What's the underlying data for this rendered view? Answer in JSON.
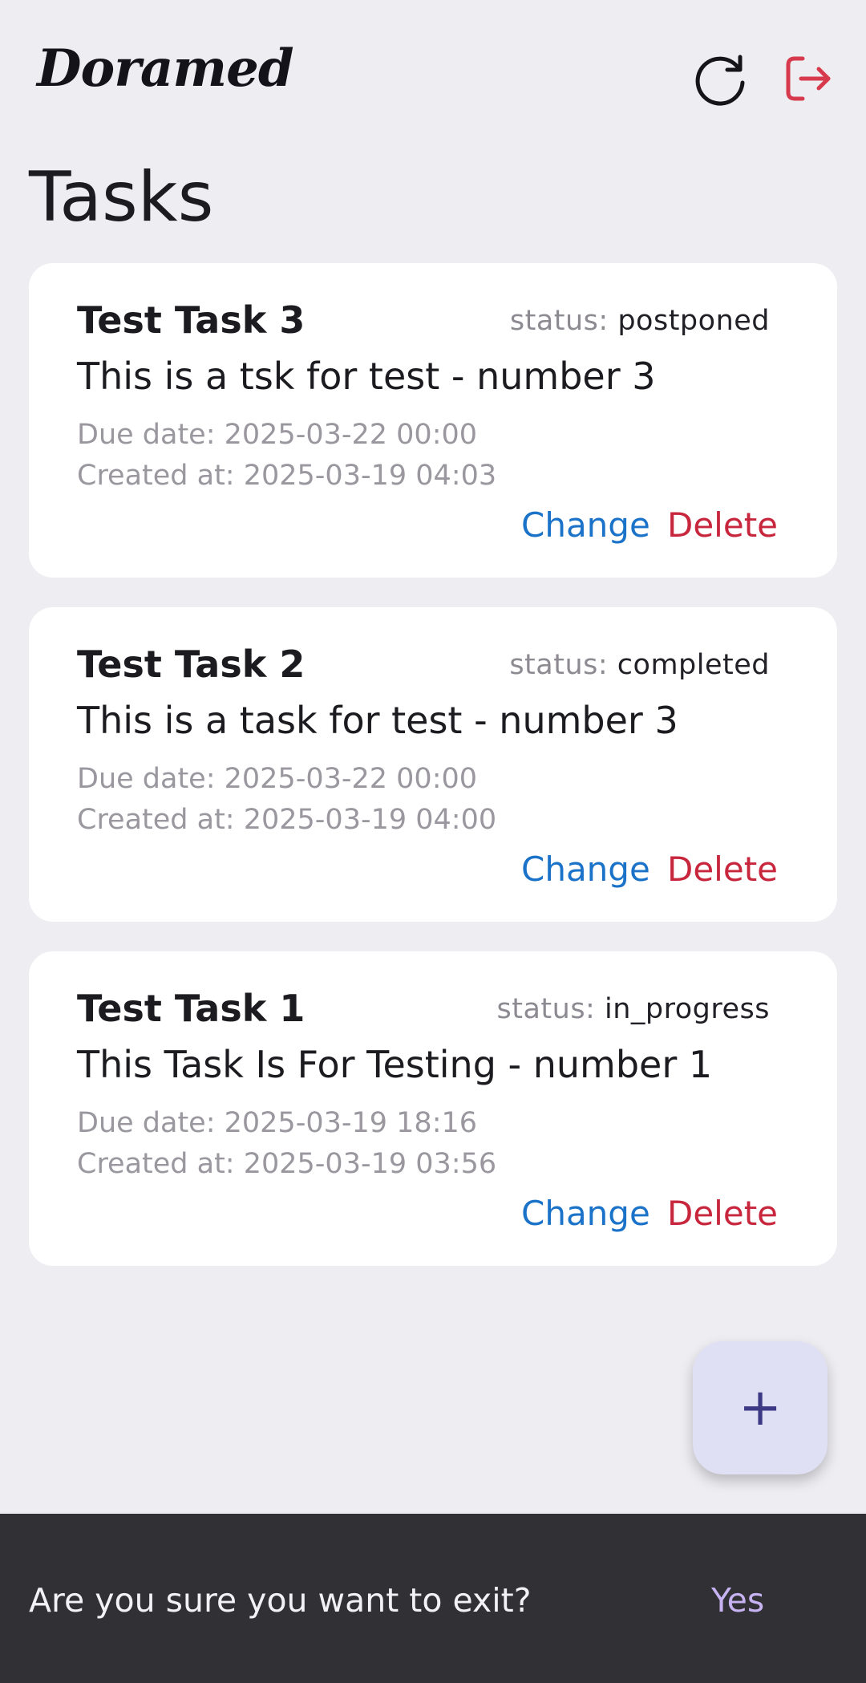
{
  "header": {
    "logo_text": "Doramed",
    "refresh_icon": "refresh-icon",
    "logout_icon": "logout-icon",
    "logout_color": "#d73a4c"
  },
  "page": {
    "title": "Tasks"
  },
  "tasks": [
    {
      "title": "Test Task 3",
      "status_prefix": "status:",
      "status": "postponed",
      "description": "This is a tsk for test - number 3",
      "due": "Due date: 2025-03-22  00:00",
      "created": "Created at: 2025-03-19  04:03",
      "change_label": "Change",
      "delete_label": "Delete"
    },
    {
      "title": "Test Task 2",
      "status_prefix": "status:",
      "status": "completed",
      "description": "This is a task for test - number 3",
      "due": "Due date: 2025-03-22  00:00",
      "created": "Created at: 2025-03-19  04:00",
      "change_label": "Change",
      "delete_label": "Delete"
    },
    {
      "title": "Test Task 1",
      "status_prefix": "status:",
      "status": "in_progress",
      "description": "This Task Is For Testing - number 1",
      "due": "Due date: 2025-03-19  18:16",
      "created": "Created at: 2025-03-19  03:56",
      "change_label": "Change",
      "delete_label": "Delete"
    }
  ],
  "fab": {
    "icon": "plus-icon",
    "glyph": "+"
  },
  "snackbar": {
    "message": "Are you sure you want to exit?",
    "action_label": "Yes"
  },
  "colors": {
    "background": "#eeedf2",
    "card": "#ffffff",
    "change": "#1a73c8",
    "delete": "#c8263d",
    "fab": "#dfe0f4",
    "snackbar": "#313035",
    "snackbar_action": "#c7b3f2"
  }
}
